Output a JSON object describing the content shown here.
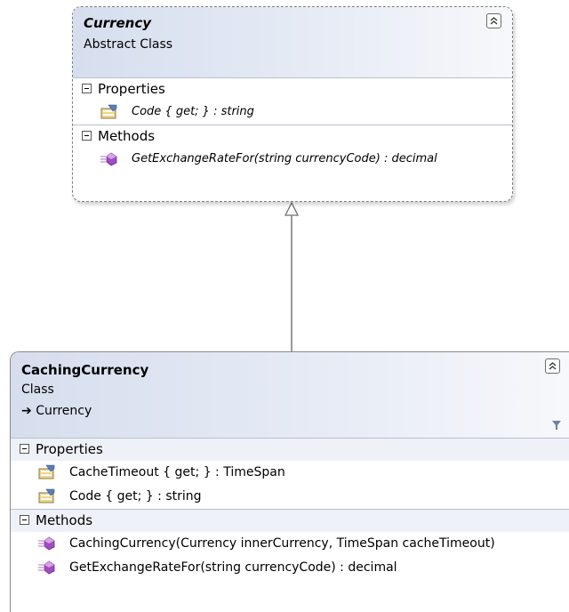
{
  "abstract_class": {
    "name": "Currency",
    "stereotype": "Abstract Class",
    "properties_label": "Properties",
    "methods_label": "Methods",
    "properties": [
      "Code { get; } : string"
    ],
    "methods": [
      "GetExchangeRateFor(string currencyCode) : decimal"
    ]
  },
  "concrete_class": {
    "name": "CachingCurrency",
    "stereotype": "Class",
    "inherits": "Currency",
    "properties_label": "Properties",
    "methods_label": "Methods",
    "properties": [
      "CacheTimeout { get; } : TimeSpan",
      "Code { get; } : string"
    ],
    "methods": [
      "CachingCurrency(Currency innerCurrency, TimeSpan cacheTimeout)",
      "GetExchangeRateFor(string currencyCode) : decimal"
    ]
  },
  "icons": {
    "collapse": "double-chevron-up-icon",
    "property": "property-icon",
    "method": "method-icon",
    "inherit_arrow": "inherit-arrow-icon",
    "filter": "filter-icon"
  },
  "colors": {
    "header_gradient_start": "#d6deee",
    "header_gradient_end": "#f7f8fb",
    "method_icon": "#a24bc2",
    "property_icon": "#e2b53a"
  }
}
